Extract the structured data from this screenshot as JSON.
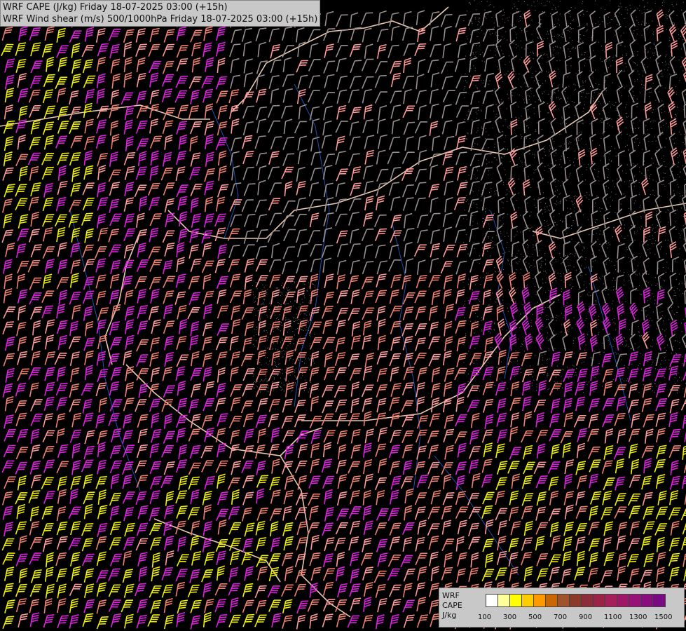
{
  "title": {
    "line1": "WRF CAPE (J/kg) Friday 18-07-2025 03:00 (+15h)",
    "line2": "WRF Wind shear (m/s) 500/1000hPa Friday 18-07-2025 03:00 (+15h)"
  },
  "legend": {
    "row1": "WRF",
    "row2": "CAPE",
    "row3": "J/kg",
    "colors": [
      "#ffffff",
      "#ffff99",
      "#ffff00",
      "#ffcc00",
      "#ff9900",
      "#cc6600",
      "#a0522d",
      "#8b3a2a",
      "#8b2e3a",
      "#9b2348",
      "#a61e5a",
      "#a0176a",
      "#961278",
      "#880e7e",
      "#7a0a82"
    ],
    "ticks": [
      "100",
      "300",
      "500",
      "700",
      "900",
      "1100",
      "1300",
      "1500"
    ]
  },
  "barb_colors": {
    "light": "#9a8f8f",
    "salmon": "#f08070",
    "magenta": "#e020e0",
    "yellow": "#f0f000",
    "pink": "#ff9a9a"
  },
  "map_colors": {
    "border": "#e8c8b0",
    "river": "#2050b0",
    "cape_speckle": "#ffffff"
  }
}
